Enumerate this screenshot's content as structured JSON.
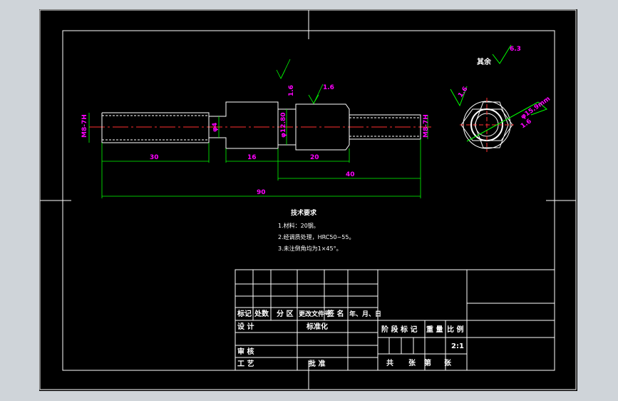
{
  "drawing": {
    "roughness_rest": "6.3",
    "roughness_rest_label": "其余",
    "dims": {
      "thread_left": "M8-7H",
      "dia_left": "φ4",
      "dia_mid": "φ12.80",
      "thread_right": "M8-7H",
      "len_30": "30",
      "len_16": "16",
      "len_20": "20",
      "len_40": "40",
      "len_90": "90",
      "rough_1": "1.6",
      "rough_2": "1.6",
      "rough_3": "1.6",
      "rough_4": "1.6",
      "hex_dim": "φ15.9mm"
    },
    "tech_req_title": "技术要求",
    "tech_req": [
      "1.材料：20钢。",
      "2.经调质处理，HRC50~55。",
      "3.未注倒角均为1×45°。"
    ]
  },
  "title_block": {
    "rev_headers": [
      "标记",
      "处数",
      "分 区",
      "更改文件号",
      "签 名",
      "年、月、日"
    ],
    "design": "设 计",
    "standard": "标准化",
    "review": "审 核",
    "process": "工 艺",
    "approve": "批 准",
    "stage_mark": "阶 段 标 记",
    "weight": "重 量",
    "scale": "比 例",
    "scale_value": "2:1",
    "total": "共",
    "sheets1": "张",
    "nth": "第",
    "sheets2": "张"
  }
}
